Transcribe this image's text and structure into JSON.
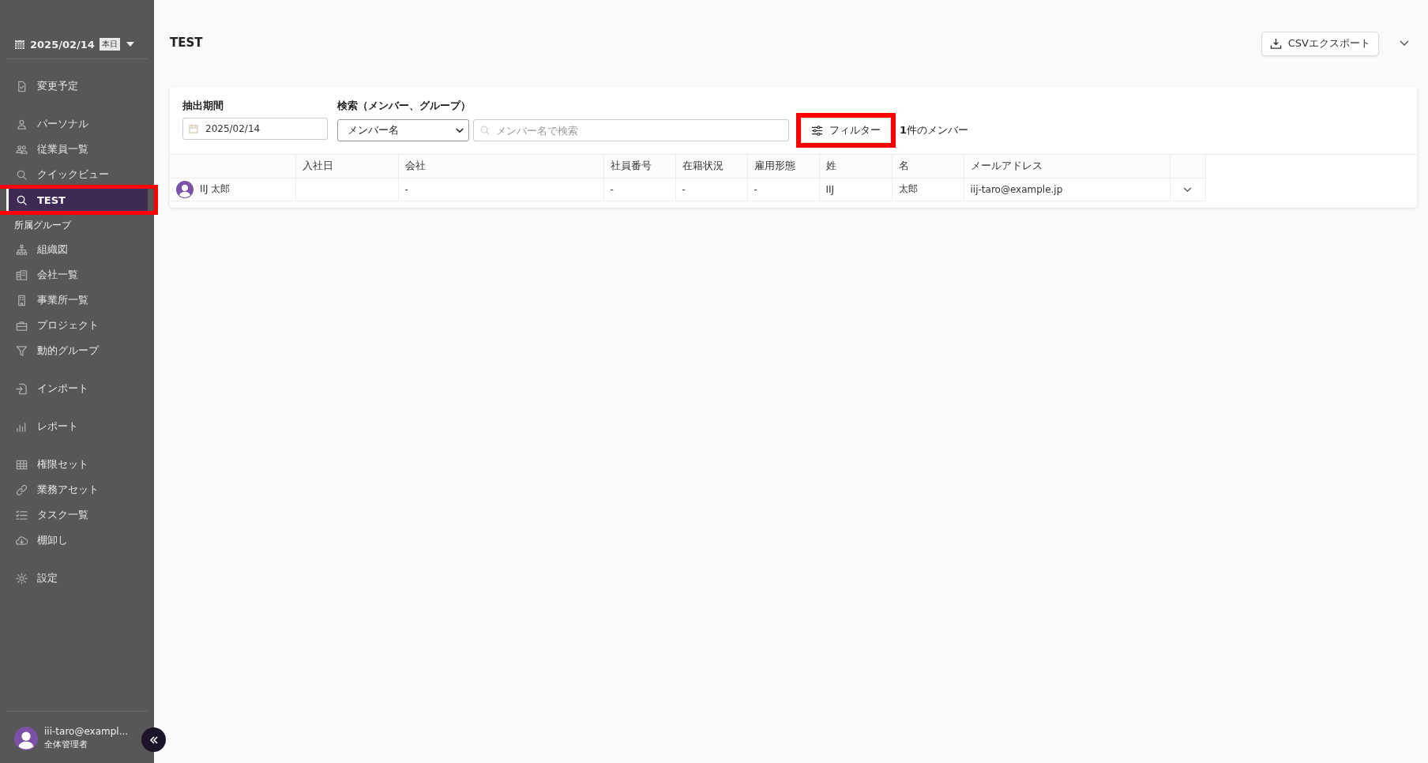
{
  "sidebar": {
    "date": "2025/02/14",
    "today_badge": "本日",
    "groups": [
      {
        "items": [
          {
            "label": "変更予定",
            "selected": false,
            "highlighted": false
          }
        ]
      },
      {
        "items": [
          {
            "label": "パーソナル",
            "selected": false,
            "highlighted": false
          },
          {
            "label": "従業員一覧",
            "selected": false,
            "highlighted": false
          },
          {
            "label": "クイックビュー",
            "selected": false,
            "highlighted": false
          },
          {
            "label": "TEST",
            "selected": true,
            "highlighted": true
          }
        ]
      },
      {
        "label": "所属グループ",
        "items": [
          {
            "label": "組織図",
            "selected": false,
            "highlighted": false
          },
          {
            "label": "会社一覧",
            "selected": false,
            "highlighted": false
          },
          {
            "label": "事業所一覧",
            "selected": false,
            "highlighted": false
          },
          {
            "label": "プロジェクト",
            "selected": false,
            "highlighted": false
          },
          {
            "label": "動的グループ",
            "selected": false,
            "highlighted": false
          }
        ]
      },
      {
        "items": [
          {
            "label": "インポート",
            "selected": false,
            "highlighted": false
          }
        ]
      },
      {
        "items": [
          {
            "label": "レポート",
            "selected": false,
            "highlighted": false
          }
        ]
      },
      {
        "items": [
          {
            "label": "権限セット",
            "selected": false,
            "highlighted": false
          },
          {
            "label": "業務アセット",
            "selected": false,
            "highlighted": false
          },
          {
            "label": "タスク一覧",
            "selected": false,
            "highlighted": false
          },
          {
            "label": "棚卸し",
            "selected": false,
            "highlighted": false
          }
        ]
      },
      {
        "items": [
          {
            "label": "設定",
            "selected": false,
            "highlighted": false
          }
        ]
      }
    ],
    "user": {
      "email": "iii-taro@exampl...",
      "role": "全体管理者"
    }
  },
  "page": {
    "title": "TEST",
    "export_button": "CSVエクスポート"
  },
  "filters": {
    "period_label": "抽出期間",
    "period_value": "2025/02/14",
    "search_label": "検索（メンバー、グループ）",
    "search_type": "メンバー名",
    "search_placeholder": "メンバー名で検索",
    "filter_button": {
      "label": "フィルター",
      "highlighted": true
    },
    "count": "**1**件のメンバー"
  },
  "table": {
    "columns": [
      "入社日",
      "会社",
      "社員番号",
      "在籍状況",
      "雇用形態",
      "姓",
      "名",
      "メールアドレス"
    ],
    "rows": [
      {
        "member": "IIJ 太郎",
        "cells": [
          null,
          "-",
          "-",
          "-",
          "-",
          "IIJ",
          "太郎",
          "iij-taro@example.jp"
        ]
      }
    ]
  }
}
